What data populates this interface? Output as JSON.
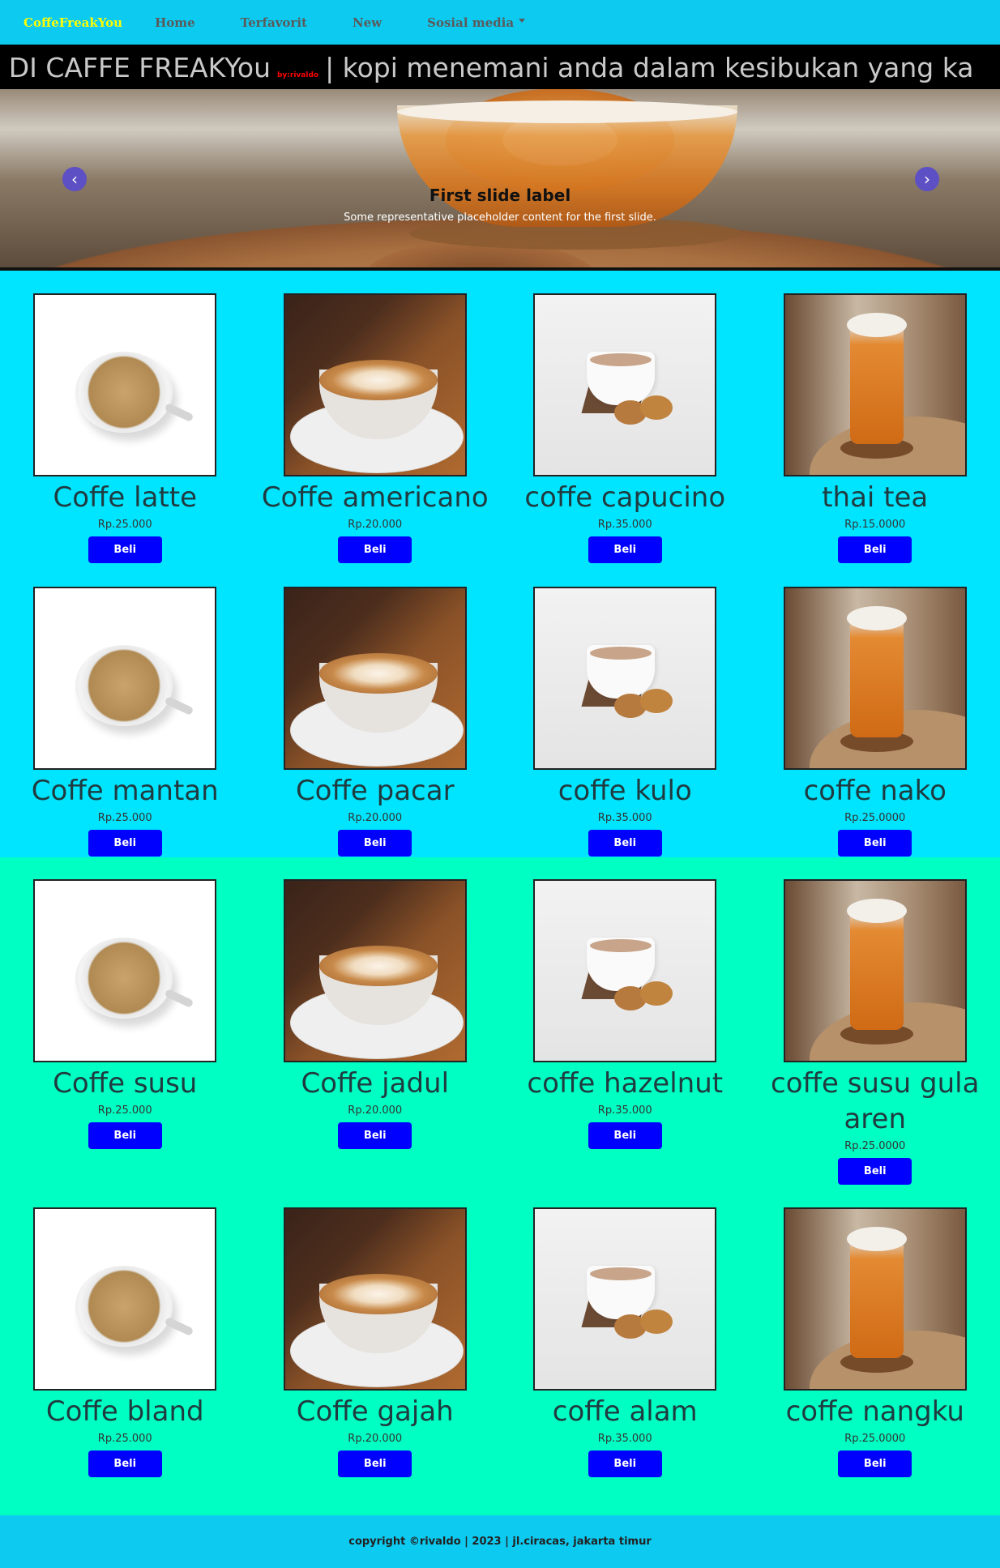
{
  "navbar": {
    "brand": "CoffeFreakYou",
    "links": [
      "Home",
      "Terfavorit",
      "New"
    ],
    "dropdown": "Sosial media"
  },
  "marquee": {
    "text_before": "NG DI CAFFE FREAKYou",
    "byline": "by:rivaldo",
    "text_after": "| kopi menemani anda dalam kesibukan yang ka"
  },
  "carousel": {
    "title": "First slide label",
    "text": "Some representative placeholder content for the first slide.",
    "prev": "‹",
    "next": "›"
  },
  "buy_label": "Beli",
  "products": [
    [
      {
        "name": "Coffe latte",
        "price": "Rp.25.000",
        "image": "latte"
      },
      {
        "name": "Coffe americano",
        "price": "Rp.20.000",
        "image": "americano"
      },
      {
        "name": "coffe capucino",
        "price": "Rp.35.000",
        "image": "capucino"
      },
      {
        "name": "thai tea",
        "price": "Rp.15.0000",
        "image": "thai"
      }
    ],
    [
      {
        "name": "Coffe mantan",
        "price": "Rp.25.000",
        "image": "latte"
      },
      {
        "name": "Coffe pacar",
        "price": "Rp.20.000",
        "image": "americano"
      },
      {
        "name": "coffe kulo",
        "price": "Rp.35.000",
        "image": "capucino"
      },
      {
        "name": "coffe nako",
        "price": "Rp.25.0000",
        "image": "thai"
      }
    ],
    [
      {
        "name": "Coffe susu",
        "price": "Rp.25.000",
        "image": "latte"
      },
      {
        "name": "Coffe jadul",
        "price": "Rp.20.000",
        "image": "americano"
      },
      {
        "name": "coffe hazelnut",
        "price": "Rp.35.000",
        "image": "capucino"
      },
      {
        "name": "coffe susu gula aren",
        "price": "Rp.25.0000",
        "image": "thai"
      }
    ],
    [
      {
        "name": "Coffe bland",
        "price": "Rp.25.000",
        "image": "latte"
      },
      {
        "name": "Coffe gajah",
        "price": "Rp.20.000",
        "image": "americano"
      },
      {
        "name": "coffe alam",
        "price": "Rp.35.000",
        "image": "capucino"
      },
      {
        "name": "coffe nangku",
        "price": "Rp.25.0000",
        "image": "thai"
      }
    ]
  ],
  "footer": {
    "text": "copyright ©rivaldo | 2023 | jl.ciracas, jakarta timur"
  }
}
